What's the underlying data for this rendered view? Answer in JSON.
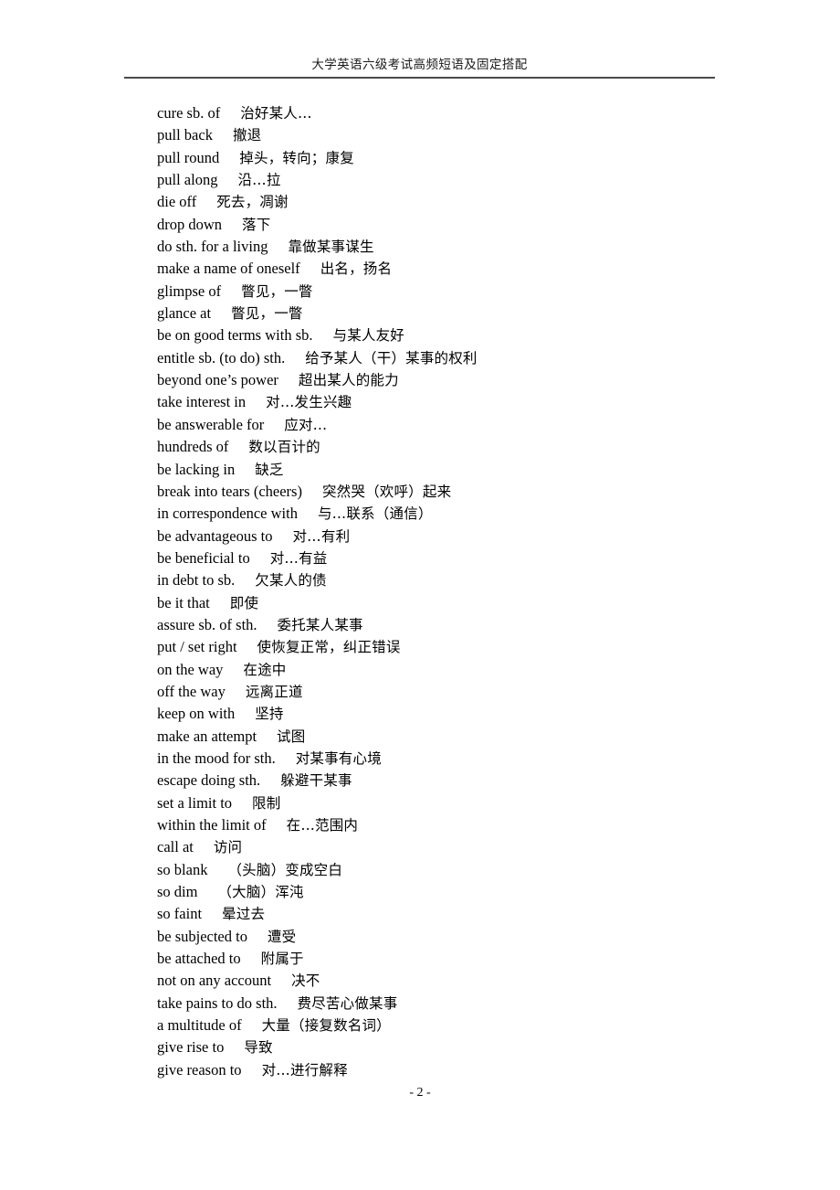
{
  "header": {
    "title": "大学英语六级考试高频短语及固定搭配"
  },
  "footer": {
    "page_number": "- 2 -"
  },
  "entries": [
    {
      "en": "cure sb. of",
      "gap": 22,
      "zh": "治好某人…"
    },
    {
      "en": "pull back",
      "gap": 22,
      "zh": "撤退"
    },
    {
      "en": "pull round",
      "gap": 22,
      "zh": "掉头，转向；康复"
    },
    {
      "en": "pull along",
      "gap": 22,
      "zh": "沿…拉"
    },
    {
      "en": "die off",
      "gap": 22,
      "zh": "死去，凋谢"
    },
    {
      "en": "drop down",
      "gap": 22,
      "zh": "落下"
    },
    {
      "en": "do sth. for a living",
      "gap": 22,
      "zh": "靠做某事谋生"
    },
    {
      "en": "make a name of oneself",
      "gap": 22,
      "zh": "出名，扬名"
    },
    {
      "en": "glimpse of",
      "gap": 22,
      "zh": "瞥见，一瞥"
    },
    {
      "en": "glance at",
      "gap": 22,
      "zh": "瞥见，一瞥"
    },
    {
      "en": "be on good terms with sb.",
      "gap": 22,
      "zh": "与某人友好"
    },
    {
      "en": "entitle sb. (to do) sth.",
      "gap": 22,
      "zh": "给予某人（干）某事的权利"
    },
    {
      "en": "beyond one’s power",
      "gap": 22,
      "zh": "超出某人的能力"
    },
    {
      "en": "take interest in",
      "gap": 22,
      "zh": "对…发生兴趣"
    },
    {
      "en": "be answerable for",
      "gap": 22,
      "zh": "应对…"
    },
    {
      "en": "hundreds of",
      "gap": 22,
      "zh": "数以百计的"
    },
    {
      "en": "be lacking in",
      "gap": 22,
      "zh": "缺乏"
    },
    {
      "en": "break into tears (cheers)",
      "gap": 22,
      "zh": "突然哭（欢呼）起来"
    },
    {
      "en": "in correspondence with",
      "gap": 22,
      "zh": "与…联系（通信）"
    },
    {
      "en": "be advantageous to",
      "gap": 22,
      "zh": "对…有利"
    },
    {
      "en": "be beneficial to",
      "gap": 22,
      "zh": "对…有益"
    },
    {
      "en": "in debt to sb.",
      "gap": 22,
      "zh": "欠某人的债"
    },
    {
      "en": "be it that",
      "gap": 22,
      "zh": "即使"
    },
    {
      "en": "assure sb. of sth.",
      "gap": 22,
      "zh": "委托某人某事"
    },
    {
      "en": "put / set right",
      "gap": 22,
      "zh": "使恢复正常，纠正错误"
    },
    {
      "en": "on the way",
      "gap": 22,
      "zh": "在途中"
    },
    {
      "en": "off the way",
      "gap": 22,
      "zh": "远离正道"
    },
    {
      "en": "keep on with",
      "gap": 22,
      "zh": "坚持"
    },
    {
      "en": "make an attempt",
      "gap": 22,
      "zh": "试图"
    },
    {
      "en": "in the mood for sth.",
      "gap": 22,
      "zh": "对某事有心境"
    },
    {
      "en": "escape doing sth.",
      "gap": 22,
      "zh": "躲避干某事"
    },
    {
      "en": "set a limit to",
      "gap": 22,
      "zh": "限制"
    },
    {
      "en": "within the limit of",
      "gap": 22,
      "zh": "在…范围内"
    },
    {
      "en": "call at",
      "gap": 22,
      "zh": "访问"
    },
    {
      "en": "so blank",
      "gap": 22,
      "zh": "（头脑）变成空白"
    },
    {
      "en": "so dim",
      "gap": 22,
      "zh": "（大脑）浑沌"
    },
    {
      "en": "so faint",
      "gap": 22,
      "zh": "晕过去"
    },
    {
      "en": "be subjected to",
      "gap": 22,
      "zh": "遭受"
    },
    {
      "en": "be attached to",
      "gap": 22,
      "zh": "附属于"
    },
    {
      "en": "not on any account",
      "gap": 22,
      "zh": "决不"
    },
    {
      "en": "take pains to do sth.",
      "gap": 22,
      "zh": "费尽苦心做某事"
    },
    {
      "en": "a multitude of",
      "gap": 22,
      "zh": "大量（接复数名词）"
    },
    {
      "en": "give rise to",
      "gap": 22,
      "zh": "导致"
    },
    {
      "en": "give reason to",
      "gap": 22,
      "zh": "对…进行解释"
    }
  ]
}
